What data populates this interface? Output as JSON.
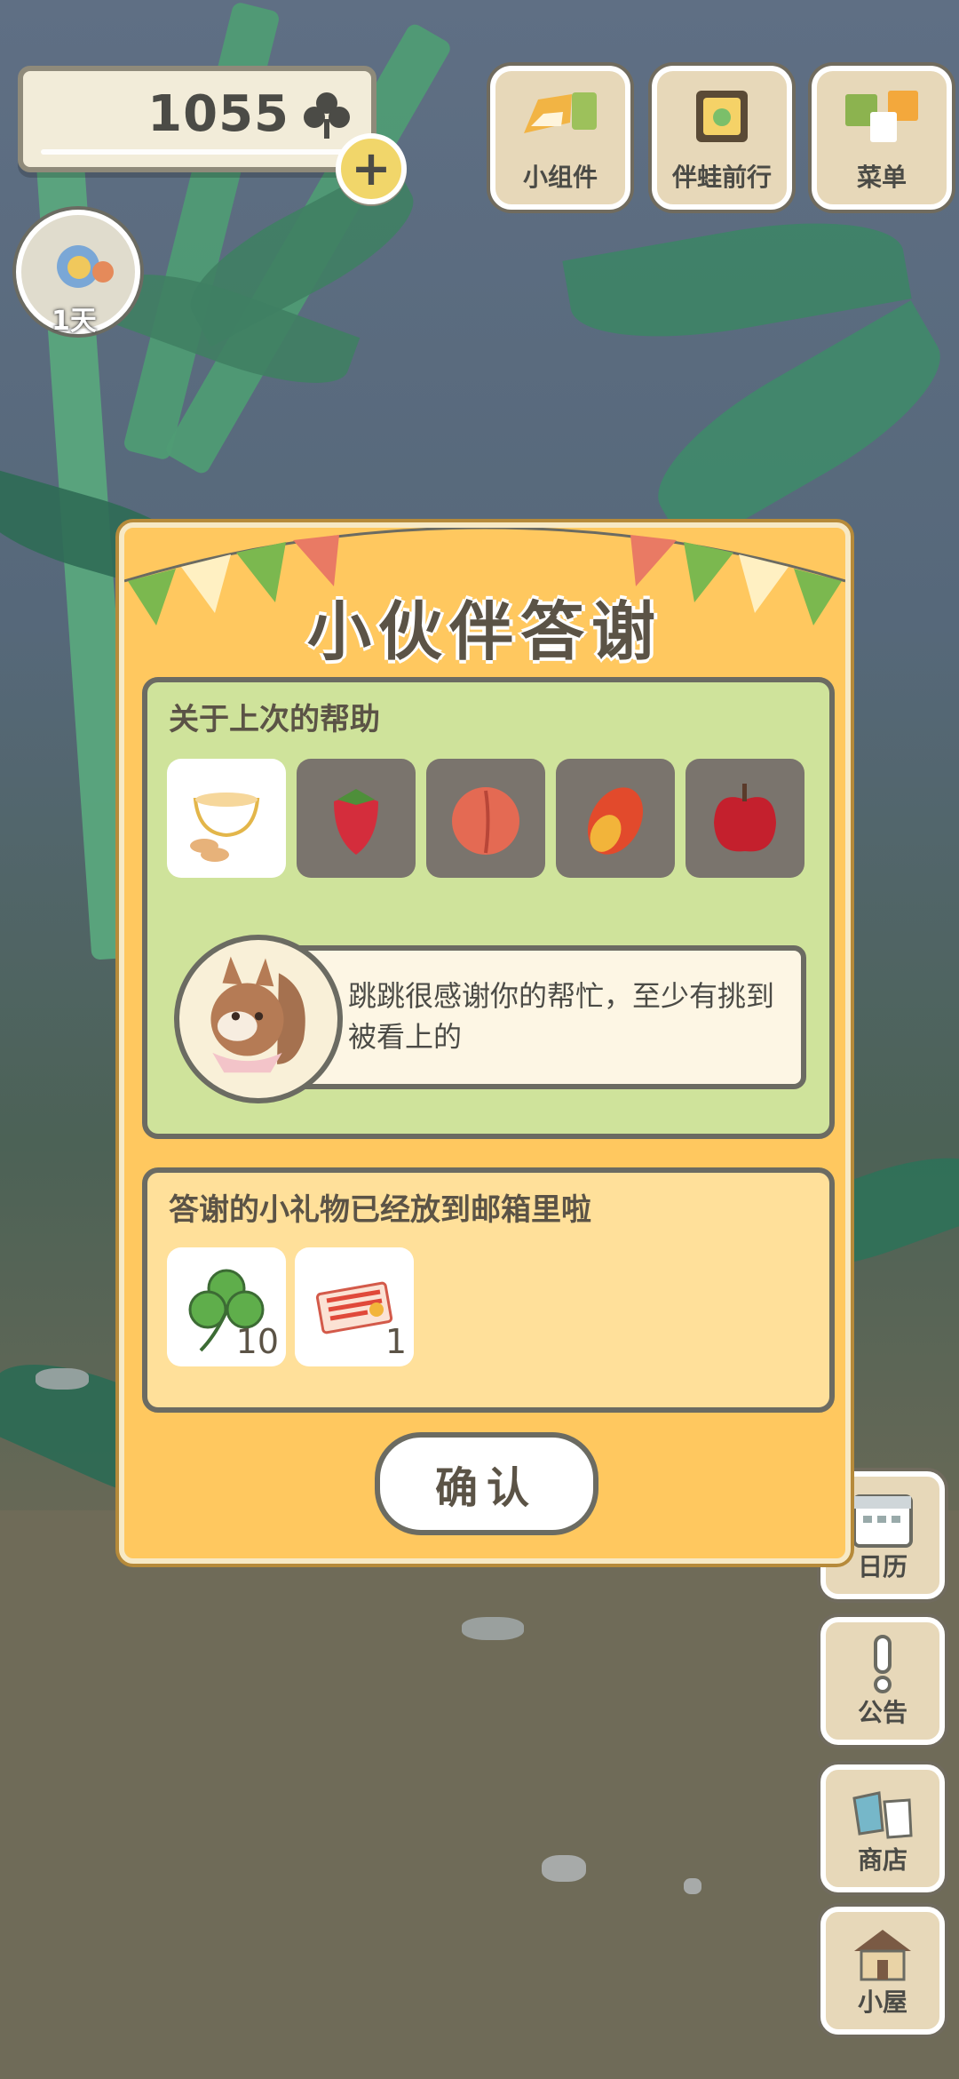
{
  "hud": {
    "clover_count": "1055",
    "day_label": "1天"
  },
  "top_menu": {
    "widgets_label": "小组件",
    "travel_label": "伴蛙前行",
    "menu_label": "菜单"
  },
  "side_menu": {
    "calendar_label": "日历",
    "notice_label": "公告",
    "shop_label": "商店",
    "house_label": "小屋"
  },
  "dialog": {
    "title": "小伙伴答谢",
    "help_section_title": "关于上次的帮助",
    "help_items": [
      "tea-and-cookies",
      "strawberry",
      "peach",
      "mango",
      "apple"
    ],
    "message": "跳跳很感谢你的帮忙，至少有挑到被看上的",
    "gift_section_title": "答谢的小礼物已经放到邮箱里啦",
    "gifts": [
      {
        "icon": "clover-icon",
        "qty": "10"
      },
      {
        "icon": "ticket-icon",
        "qty": "1"
      }
    ],
    "confirm_label": "确认"
  },
  "colors": {
    "dialog_bg": "#ffc85f",
    "green_panel": "#cfe39b",
    "yellow_panel": "#ffe09a",
    "text_dark": "#5b5346"
  }
}
